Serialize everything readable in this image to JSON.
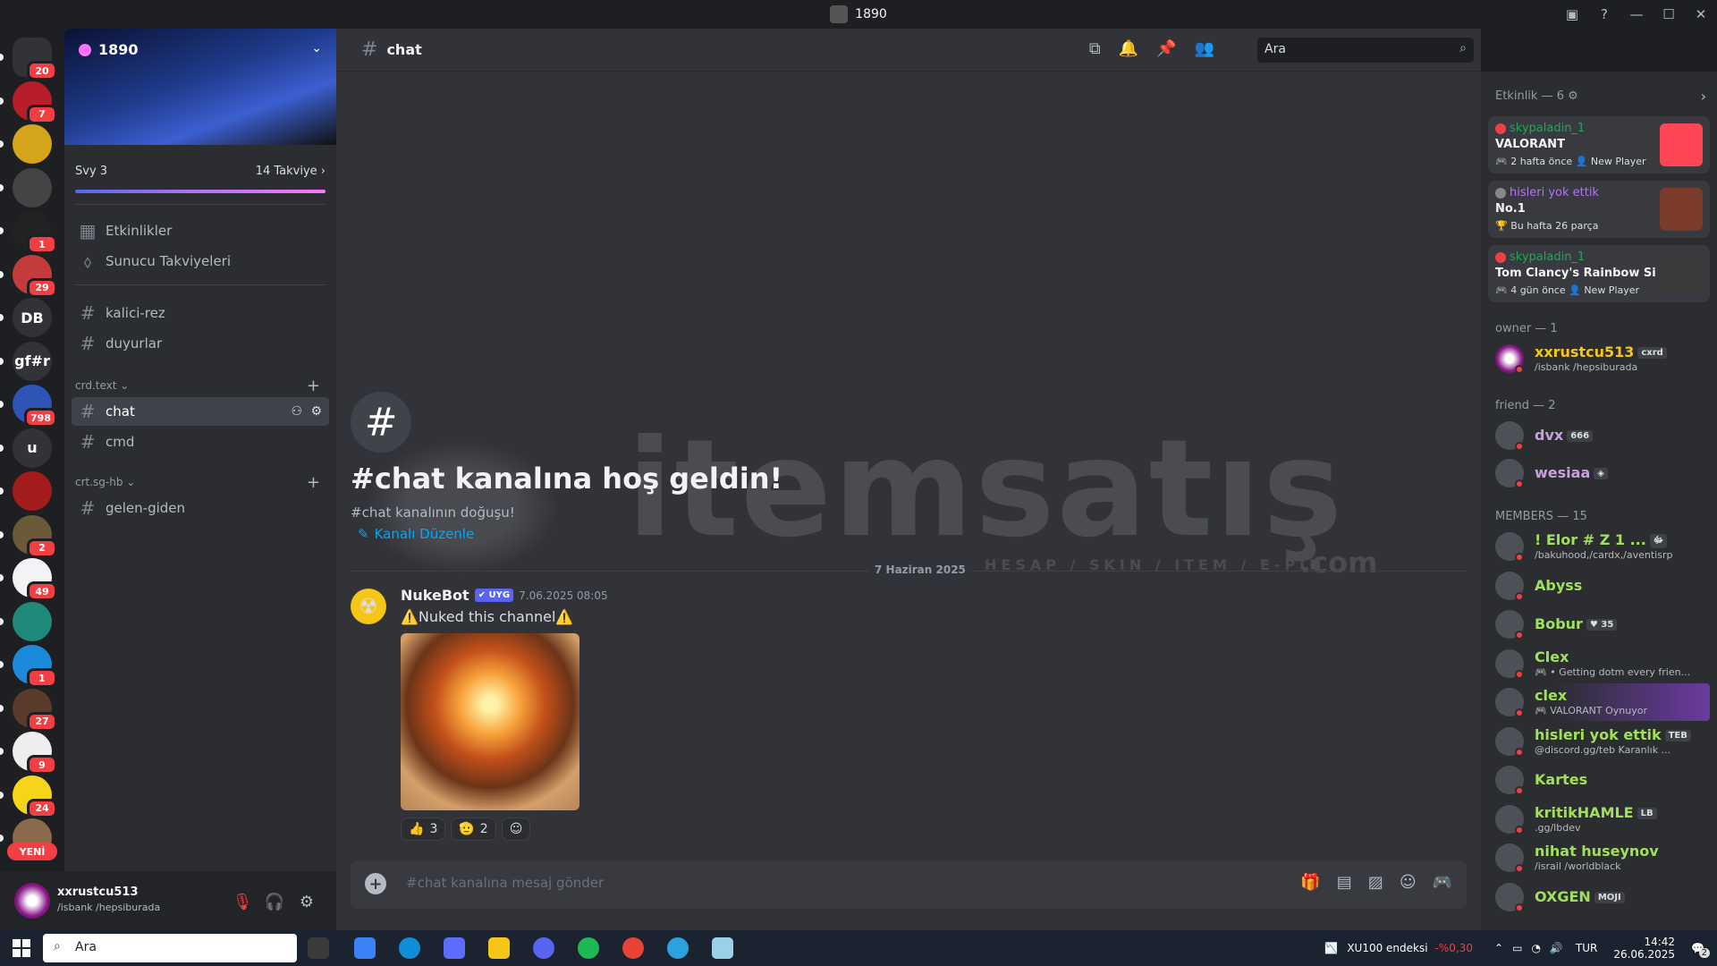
{
  "window": {
    "title": "1890"
  },
  "rail": {
    "items": [
      {
        "label": "",
        "badge": "20",
        "color": "#313338"
      },
      {
        "label": "",
        "badge": "7",
        "color": "#b81d2a"
      },
      {
        "label": "",
        "badge": "",
        "color": "#d4a51a"
      },
      {
        "label": "",
        "badge": "",
        "color": "#444"
      },
      {
        "label": "",
        "badge": "1",
        "color": "#222"
      },
      {
        "label": "",
        "badge": "29",
        "color": "#c43b3b"
      },
      {
        "label": "DB",
        "badge": "",
        "color": "#313338"
      },
      {
        "label": "gf#r",
        "badge": "",
        "color": "#313338"
      },
      {
        "label": "",
        "badge": "798",
        "color": "#2e54b8"
      },
      {
        "label": "u",
        "badge": "",
        "color": "#313338"
      },
      {
        "label": "",
        "badge": "",
        "color": "#a31c1c"
      },
      {
        "label": "",
        "badge": "2",
        "color": "#6b5a3a"
      },
      {
        "label": "",
        "badge": "49",
        "color": "#f2f3f5"
      },
      {
        "label": "",
        "badge": "",
        "color": "#1f8a7a"
      },
      {
        "label": "",
        "badge": "1",
        "color": "#1c8adb"
      },
      {
        "label": "",
        "badge": "27",
        "color": "#5a3a2a"
      },
      {
        "label": "",
        "badge": "9",
        "color": "#eee"
      },
      {
        "label": "",
        "badge": "24",
        "color": "#f5d41a"
      },
      {
        "label": "",
        "badge": "",
        "color": "#8a6a4a"
      }
    ],
    "new_label": "YENİ"
  },
  "server": {
    "name": "1890",
    "level": "Svy 3",
    "boosts": "14 Takviye",
    "menu": [
      {
        "label": "Etkinlikler"
      },
      {
        "label": "Sunucu Takviyeleri"
      }
    ],
    "channels_top": [
      {
        "label": "kalici-rez"
      },
      {
        "label": "duyurlar"
      }
    ],
    "cat1": "crd.text",
    "cat1_channels": [
      {
        "label": "chat"
      },
      {
        "label": "cmd"
      }
    ],
    "cat2": "crt.sg-hb",
    "cat2_channels": [
      {
        "label": "gelen-giden"
      }
    ]
  },
  "user": {
    "name": "xxrustcu513",
    "status": "/isbank /hepsiburada"
  },
  "chat": {
    "channel": "chat",
    "search_placeholder": "Ara",
    "welcome_title": "#chat kanalına hoş geldin!",
    "welcome_sub": "#chat kanalının doğuşu!",
    "edit_channel": "Kanalı Düzenle",
    "date": "7 Haziran 2025",
    "message": {
      "author": "NukeBot",
      "tag": "✔ UYG",
      "time": "7.06.2025 08:05",
      "text": "⚠️Nuked this channel⚠️"
    },
    "reactions": [
      {
        "emoji": "👍",
        "count": "3"
      },
      {
        "emoji": "🫡",
        "count": "2"
      }
    ],
    "composer_placeholder": "#chat kanalına mesaj gönder",
    "watermark": {
      "text": "itemsatış",
      "sub": "HESAP / SKIN / ITEM / E-PIN",
      "com": ".com"
    }
  },
  "activity": {
    "header": "Etkinlik — 6",
    "cards": [
      {
        "user": "skypaladin_1",
        "game": "VALORANT",
        "meta": "🎮 2 hafta önce  👤 New Player",
        "color": "#ff4655"
      },
      {
        "user": "hisleri yok ettik",
        "game": "No.1",
        "meta": "🏆 Bu hafta 26 parça",
        "color": "#7a3b2a"
      },
      {
        "user": "skypaladin_1",
        "game": "Tom Clancy's Rainbow Six ...",
        "meta": "🎮 4 gün önce  👤 New Player",
        "color": "#2b2b2b"
      }
    ]
  },
  "members": {
    "owner_header": "owner — 1",
    "owner": [
      {
        "name": "xxrustcu513",
        "tag": "cxrd",
        "sub": "/isbank /hepsiburada",
        "color": "#f5c518"
      }
    ],
    "friend_header": "friend — 2",
    "friends": [
      {
        "name": "dvx",
        "tag": "666",
        "sub": "",
        "color": "#c9a0dc"
      },
      {
        "name": "wesiaa",
        "tag": "◈",
        "sub": "",
        "color": "#c9a0dc"
      }
    ],
    "members_header": "MEMBERS — 15",
    "list": [
      {
        "name": "! Elor # Z 1 ...",
        "tag": "ﷻ",
        "sub": "/bakuhood,/cardx,/aventisrp",
        "color": "#a0e05a"
      },
      {
        "name": "Abyss",
        "tag": "",
        "sub": "",
        "color": "#a0e05a"
      },
      {
        "name": "Bobur",
        "tag": "♥ 35",
        "sub": "",
        "color": "#a0e05a"
      },
      {
        "name": "Clex",
        "tag": "",
        "sub": "🎮 • Getting dotm every frien...",
        "color": "#a0e05a"
      },
      {
        "name": "clex",
        "tag": "",
        "sub": "🎮 VALORANT Oynuyor",
        "color": "#a0e05a"
      },
      {
        "name": "hisleri yok ettik",
        "tag": "TEB",
        "sub": "@discord.gg/teb Karanlık ...",
        "color": "#a0e05a"
      },
      {
        "name": "Kartes",
        "tag": "",
        "sub": "",
        "color": "#a0e05a"
      },
      {
        "name": "kritikHAMLE",
        "tag": "LB",
        "sub": ".gg/lbdev",
        "color": "#a0e05a"
      },
      {
        "name": "nihat huseynov",
        "tag": "",
        "sub": "/israil /worldblack",
        "color": "#a0e05a"
      },
      {
        "name": "OXGEN",
        "tag": "MOJI",
        "sub": "",
        "color": "#a0e05a"
      }
    ]
  },
  "taskbar": {
    "search": "Ara",
    "stock": "XU100 endeksi",
    "stock_change": "-%0,30",
    "lang": "TUR",
    "time": "14:42",
    "date": "26.06.2025",
    "notif": "2"
  }
}
